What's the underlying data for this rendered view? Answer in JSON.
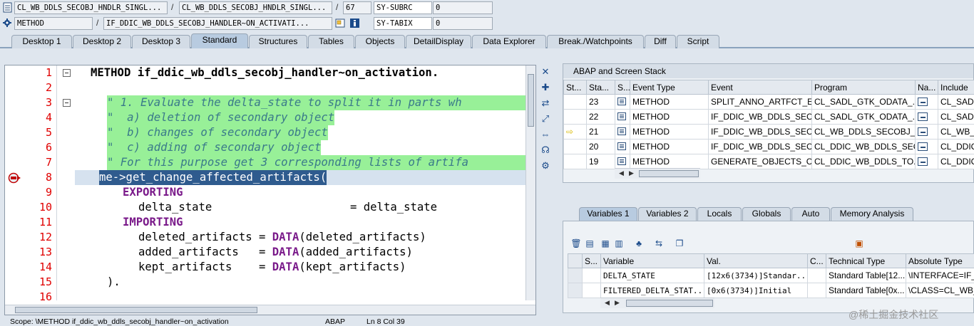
{
  "info_rows": {
    "row1": {
      "program": "CL_WB_DDLS_SECOBJ_HNDLR_SINGL...",
      "sep1": "/",
      "include": "CL_WB_DDLS_SECOBJ_HNDLR_SINGL...",
      "sep2": "/",
      "line": "67",
      "var_name": "SY-SUBRC",
      "var_value": "0"
    },
    "row2": {
      "event_type": "METHOD",
      "sep1": "/",
      "event": "IF_DDIC_WB_DDLS_SECOBJ_HANDLER~ON_ACTIVATI...",
      "var_name": "SY-TABIX",
      "var_value": "0"
    }
  },
  "tabs": [
    "Desktop 1",
    "Desktop 2",
    "Desktop 3",
    "Standard",
    "Structures",
    "Tables",
    "Objects",
    "DetailDisplay",
    "Data Explorer",
    "Break./Watchpoints",
    "Diff",
    "Script"
  ],
  "active_tab": "Standard",
  "editor": {
    "line_numbers": [
      "1",
      "2",
      "3",
      "4",
      "5",
      "6",
      "7",
      "8",
      "9",
      "10",
      "11",
      "12",
      "13",
      "14",
      "15",
      "16"
    ],
    "lines": {
      "l1_kw": "METHOD",
      "l1_name": "if_ddic_wb_ddls_secobj_handler~on_activation.",
      "l3": "\" 1. Evaluate the delta_state to split it in parts wh",
      "l4": "\"  a) deletion of secondary object",
      "l5": "\"  b) changes of secondary object",
      "l6": "\"  c) adding of secondary object",
      "l7": "\" For this purpose get 3 corresponding lists of artifa",
      "l8": "me->get_change_affected_artifacts(",
      "l9": "EXPORTING",
      "l10_a": "delta_state",
      "l10_b": "= delta_state",
      "l11": "IMPORTING",
      "l12_a": "deleted_artifacts =",
      "l12_kw": "DATA",
      "l12_b": "(deleted_artifacts)",
      "l13_a": "added_artifacts   =",
      "l13_kw": "DATA",
      "l13_b": "(added_artifacts)",
      "l14_a": "kept_artifacts    =",
      "l14_kw": "DATA",
      "l14_b": "(kept_artifacts)",
      "l15": ")."
    }
  },
  "status_bar": {
    "scope": "Scope: \\METHOD if_ddic_wb_ddls_secobj_handler~on_activation",
    "lang": "ABAP",
    "position": "Ln   8 Col  39"
  },
  "stack": {
    "title": "ABAP and Screen Stack",
    "columns": [
      "St...",
      "Sta...",
      "S...",
      "Event Type",
      "Event",
      "Program",
      "Na...",
      "Include"
    ],
    "rows": [
      {
        "status": "",
        "level": "23",
        "type": "METHOD",
        "event": "SPLIT_ANNO_ARTFCT_E...",
        "program": "CL_SADL_GTK_ODATA_...",
        "include": "CL_SADL_"
      },
      {
        "status": "",
        "level": "22",
        "type": "METHOD",
        "event": "IF_DDIC_WB_DDLS_SEC...",
        "program": "CL_SADL_GTK_ODATA_...",
        "include": "CL_SADL_"
      },
      {
        "status": "⇨",
        "level": "21",
        "type": "METHOD",
        "event": "IF_DDIC_WB_DDLS_SEC...",
        "program": "CL_WB_DDLS_SECOBJ_...",
        "include": "CL_WB_D"
      },
      {
        "status": "",
        "level": "20",
        "type": "METHOD",
        "event": "IF_DDIC_WB_DDLS_SEC...",
        "program": "CL_DDIC_WB_DDLS_SEC...",
        "include": "CL_DDIC_"
      },
      {
        "status": "",
        "level": "19",
        "type": "METHOD",
        "event": "GENERATE_OBJECTS_C...",
        "program": "CL_DDIC_WB_DDLS_TO...",
        "include": "CL_DDIC_"
      }
    ]
  },
  "var_tabs": [
    "Variables 1",
    "Variables 2",
    "Locals",
    "Globals",
    "Auto",
    "Memory Analysis"
  ],
  "active_var_tab": "Variables 1",
  "variables": {
    "columns": [
      "S...",
      "Variable",
      "Val.",
      "C...",
      "Technical Type",
      "Absolute Type"
    ],
    "rows": [
      {
        "name": "DELTA_STATE",
        "value": "[12x6(3734)]Standar...",
        "tech": "Standard Table[12...",
        "abs": "\\INTERFACE=IF_D"
      },
      {
        "name": "FILTERED_DELTA_STAT...",
        "value": "[0x6(3734)]Initial",
        "tech": "Standard Table[0x...",
        "abs": "\\CLASS=CL_WB_D"
      }
    ]
  },
  "watermark": "@稀土掘金技术社区"
}
